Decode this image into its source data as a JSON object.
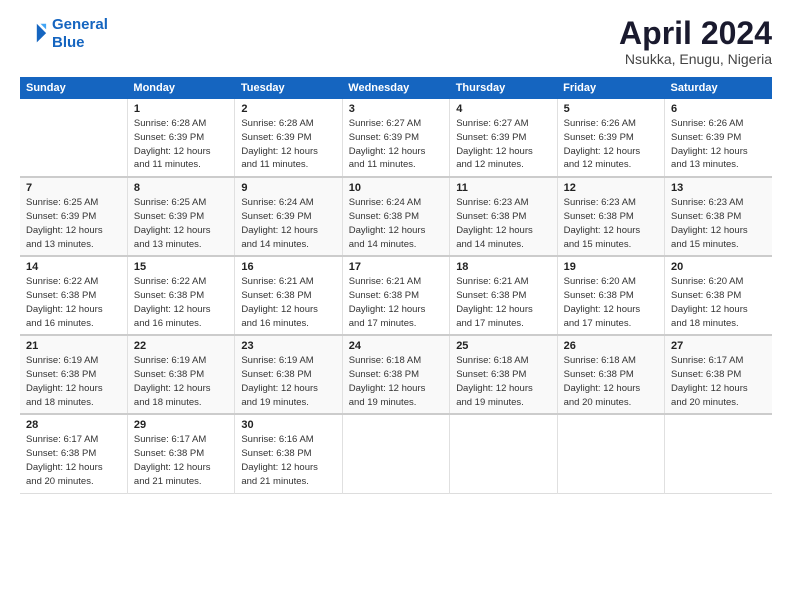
{
  "logo": {
    "line1": "General",
    "line2": "Blue"
  },
  "title": "April 2024",
  "subtitle": "Nsukka, Enugu, Nigeria",
  "days_header": [
    "Sunday",
    "Monday",
    "Tuesday",
    "Wednesday",
    "Thursday",
    "Friday",
    "Saturday"
  ],
  "weeks": [
    [
      {
        "day": "",
        "detail": ""
      },
      {
        "day": "1",
        "detail": "Sunrise: 6:28 AM\nSunset: 6:39 PM\nDaylight: 12 hours\nand 11 minutes."
      },
      {
        "day": "2",
        "detail": "Sunrise: 6:28 AM\nSunset: 6:39 PM\nDaylight: 12 hours\nand 11 minutes."
      },
      {
        "day": "3",
        "detail": "Sunrise: 6:27 AM\nSunset: 6:39 PM\nDaylight: 12 hours\nand 11 minutes."
      },
      {
        "day": "4",
        "detail": "Sunrise: 6:27 AM\nSunset: 6:39 PM\nDaylight: 12 hours\nand 12 minutes."
      },
      {
        "day": "5",
        "detail": "Sunrise: 6:26 AM\nSunset: 6:39 PM\nDaylight: 12 hours\nand 12 minutes."
      },
      {
        "day": "6",
        "detail": "Sunrise: 6:26 AM\nSunset: 6:39 PM\nDaylight: 12 hours\nand 13 minutes."
      }
    ],
    [
      {
        "day": "7",
        "detail": "Sunrise: 6:25 AM\nSunset: 6:39 PM\nDaylight: 12 hours\nand 13 minutes."
      },
      {
        "day": "8",
        "detail": "Sunrise: 6:25 AM\nSunset: 6:39 PM\nDaylight: 12 hours\nand 13 minutes."
      },
      {
        "day": "9",
        "detail": "Sunrise: 6:24 AM\nSunset: 6:39 PM\nDaylight: 12 hours\nand 14 minutes."
      },
      {
        "day": "10",
        "detail": "Sunrise: 6:24 AM\nSunset: 6:38 PM\nDaylight: 12 hours\nand 14 minutes."
      },
      {
        "day": "11",
        "detail": "Sunrise: 6:23 AM\nSunset: 6:38 PM\nDaylight: 12 hours\nand 14 minutes."
      },
      {
        "day": "12",
        "detail": "Sunrise: 6:23 AM\nSunset: 6:38 PM\nDaylight: 12 hours\nand 15 minutes."
      },
      {
        "day": "13",
        "detail": "Sunrise: 6:23 AM\nSunset: 6:38 PM\nDaylight: 12 hours\nand 15 minutes."
      }
    ],
    [
      {
        "day": "14",
        "detail": "Sunrise: 6:22 AM\nSunset: 6:38 PM\nDaylight: 12 hours\nand 16 minutes."
      },
      {
        "day": "15",
        "detail": "Sunrise: 6:22 AM\nSunset: 6:38 PM\nDaylight: 12 hours\nand 16 minutes."
      },
      {
        "day": "16",
        "detail": "Sunrise: 6:21 AM\nSunset: 6:38 PM\nDaylight: 12 hours\nand 16 minutes."
      },
      {
        "day": "17",
        "detail": "Sunrise: 6:21 AM\nSunset: 6:38 PM\nDaylight: 12 hours\nand 17 minutes."
      },
      {
        "day": "18",
        "detail": "Sunrise: 6:21 AM\nSunset: 6:38 PM\nDaylight: 12 hours\nand 17 minutes."
      },
      {
        "day": "19",
        "detail": "Sunrise: 6:20 AM\nSunset: 6:38 PM\nDaylight: 12 hours\nand 17 minutes."
      },
      {
        "day": "20",
        "detail": "Sunrise: 6:20 AM\nSunset: 6:38 PM\nDaylight: 12 hours\nand 18 minutes."
      }
    ],
    [
      {
        "day": "21",
        "detail": "Sunrise: 6:19 AM\nSunset: 6:38 PM\nDaylight: 12 hours\nand 18 minutes."
      },
      {
        "day": "22",
        "detail": "Sunrise: 6:19 AM\nSunset: 6:38 PM\nDaylight: 12 hours\nand 18 minutes."
      },
      {
        "day": "23",
        "detail": "Sunrise: 6:19 AM\nSunset: 6:38 PM\nDaylight: 12 hours\nand 19 minutes."
      },
      {
        "day": "24",
        "detail": "Sunrise: 6:18 AM\nSunset: 6:38 PM\nDaylight: 12 hours\nand 19 minutes."
      },
      {
        "day": "25",
        "detail": "Sunrise: 6:18 AM\nSunset: 6:38 PM\nDaylight: 12 hours\nand 19 minutes."
      },
      {
        "day": "26",
        "detail": "Sunrise: 6:18 AM\nSunset: 6:38 PM\nDaylight: 12 hours\nand 20 minutes."
      },
      {
        "day": "27",
        "detail": "Sunrise: 6:17 AM\nSunset: 6:38 PM\nDaylight: 12 hours\nand 20 minutes."
      }
    ],
    [
      {
        "day": "28",
        "detail": "Sunrise: 6:17 AM\nSunset: 6:38 PM\nDaylight: 12 hours\nand 20 minutes."
      },
      {
        "day": "29",
        "detail": "Sunrise: 6:17 AM\nSunset: 6:38 PM\nDaylight: 12 hours\nand 21 minutes."
      },
      {
        "day": "30",
        "detail": "Sunrise: 6:16 AM\nSunset: 6:38 PM\nDaylight: 12 hours\nand 21 minutes."
      },
      {
        "day": "",
        "detail": ""
      },
      {
        "day": "",
        "detail": ""
      },
      {
        "day": "",
        "detail": ""
      },
      {
        "day": "",
        "detail": ""
      }
    ]
  ]
}
